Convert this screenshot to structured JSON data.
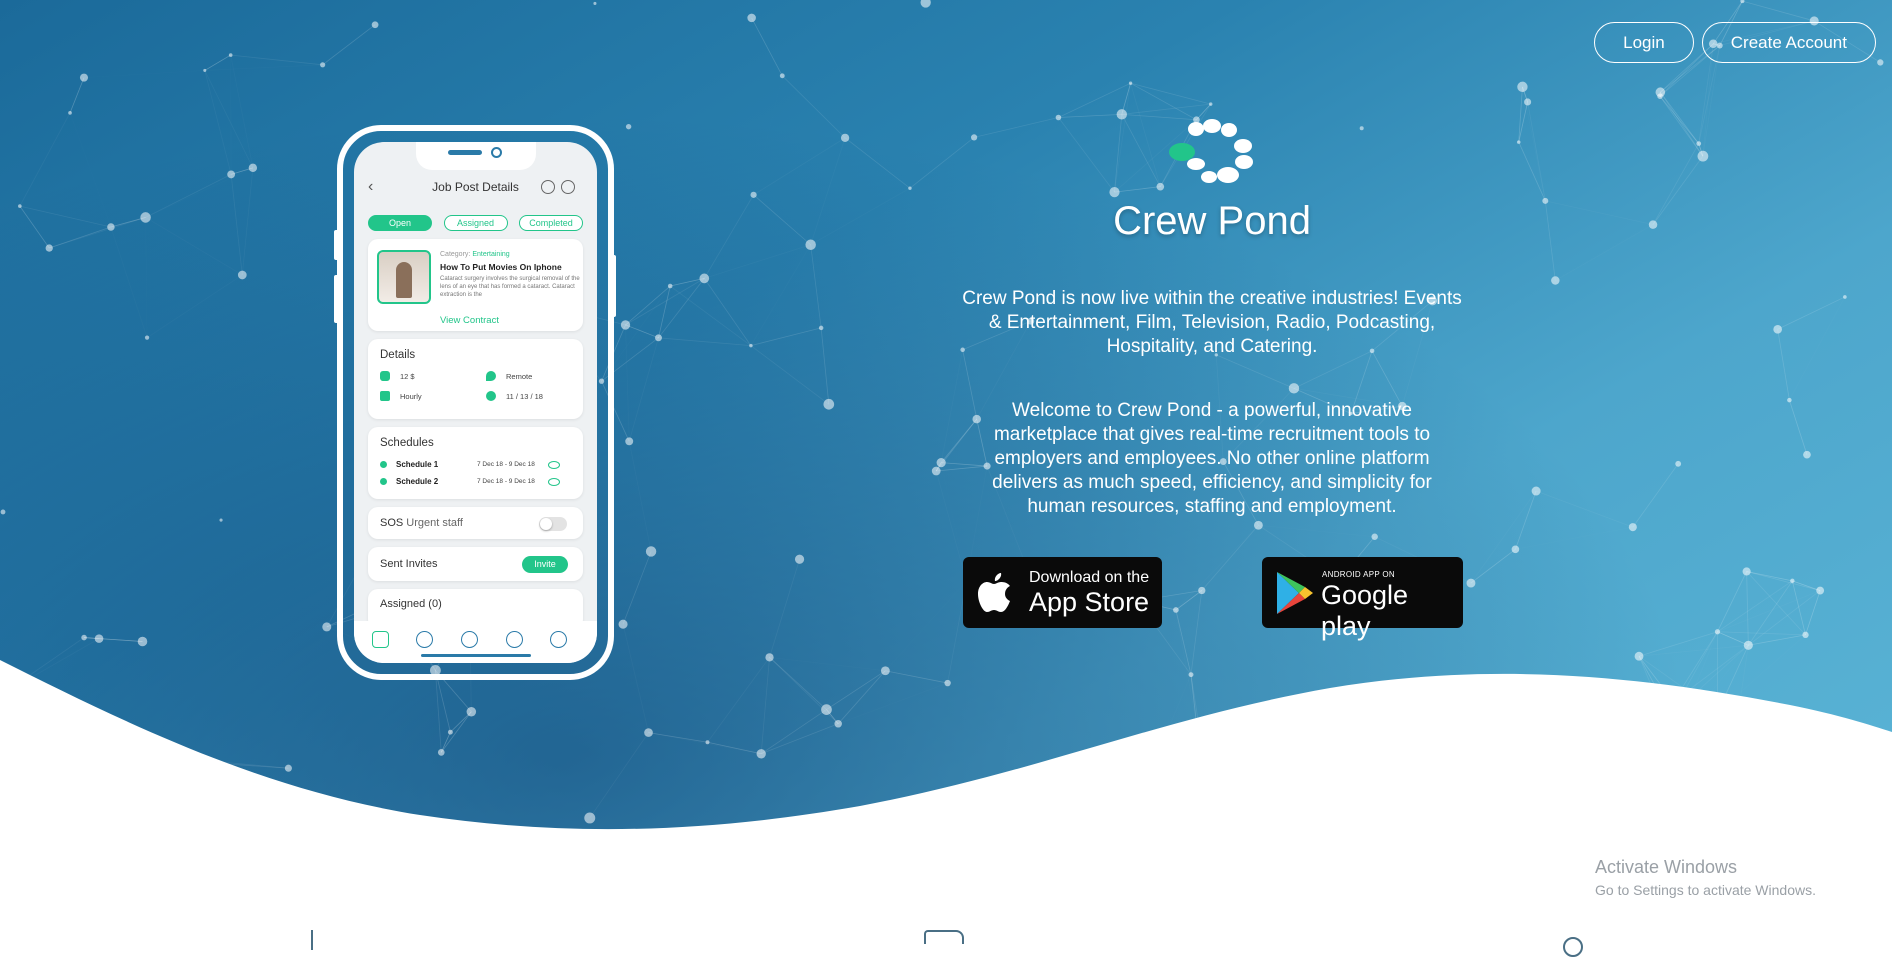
{
  "nav": {
    "login": "Login",
    "create_account": "Create Account"
  },
  "brand": {
    "name": "Crew Pond"
  },
  "hero": {
    "tagline": "Crew Pond is now live within the creative industries! Events & Entertainment, Film, Television, Radio, Podcasting, Hospitality, and Catering.",
    "welcome": "Welcome to Crew Pond - a powerful, innovative marketplace that gives real-time recruitment tools to employers and employees. No other online platform delivers as much speed, efficiency, and simplicity for human resources, staffing and employment."
  },
  "stores": {
    "appstore_small": "Download on the",
    "appstore_big": "App Store",
    "play_small": "ANDROID APP ON",
    "play_big": "Google play"
  },
  "phone": {
    "title": "Job Post Details",
    "tabs": [
      "Open",
      "Assigned",
      "Completed"
    ],
    "job": {
      "category_label": "Category:",
      "category": "Entertaining",
      "title": "How To Put Movies On Iphone",
      "description": "Cataract surgery involves the surgical removal of the lens of an eye that has formed a cataract. Cataract extraction is the",
      "link": "View Contract"
    },
    "details": {
      "title": "Details",
      "rate": "12 $",
      "location": "Remote",
      "type": "Hourly",
      "date": "11 / 13 / 18"
    },
    "schedules": {
      "title": "Schedules",
      "items": [
        {
          "name": "Schedule 1",
          "dates": "7 Dec 18 - 9 Dec 18"
        },
        {
          "name": "Schedule 2",
          "dates": "7 Dec 18 - 9 Dec 18"
        }
      ]
    },
    "sos": {
      "label": "SOS",
      "sub": "Urgent staff"
    },
    "invites": {
      "label": "Sent Invites",
      "button": "Invite"
    },
    "assigned": {
      "label": "Assigned (0)"
    }
  },
  "watermark": {
    "title": "Activate Windows",
    "subtitle": "Go to Settings to activate Windows."
  },
  "colors": {
    "accent": "#22c58a",
    "hero_dark": "#1b6a9a",
    "hero_light": "#5cb6d7"
  }
}
